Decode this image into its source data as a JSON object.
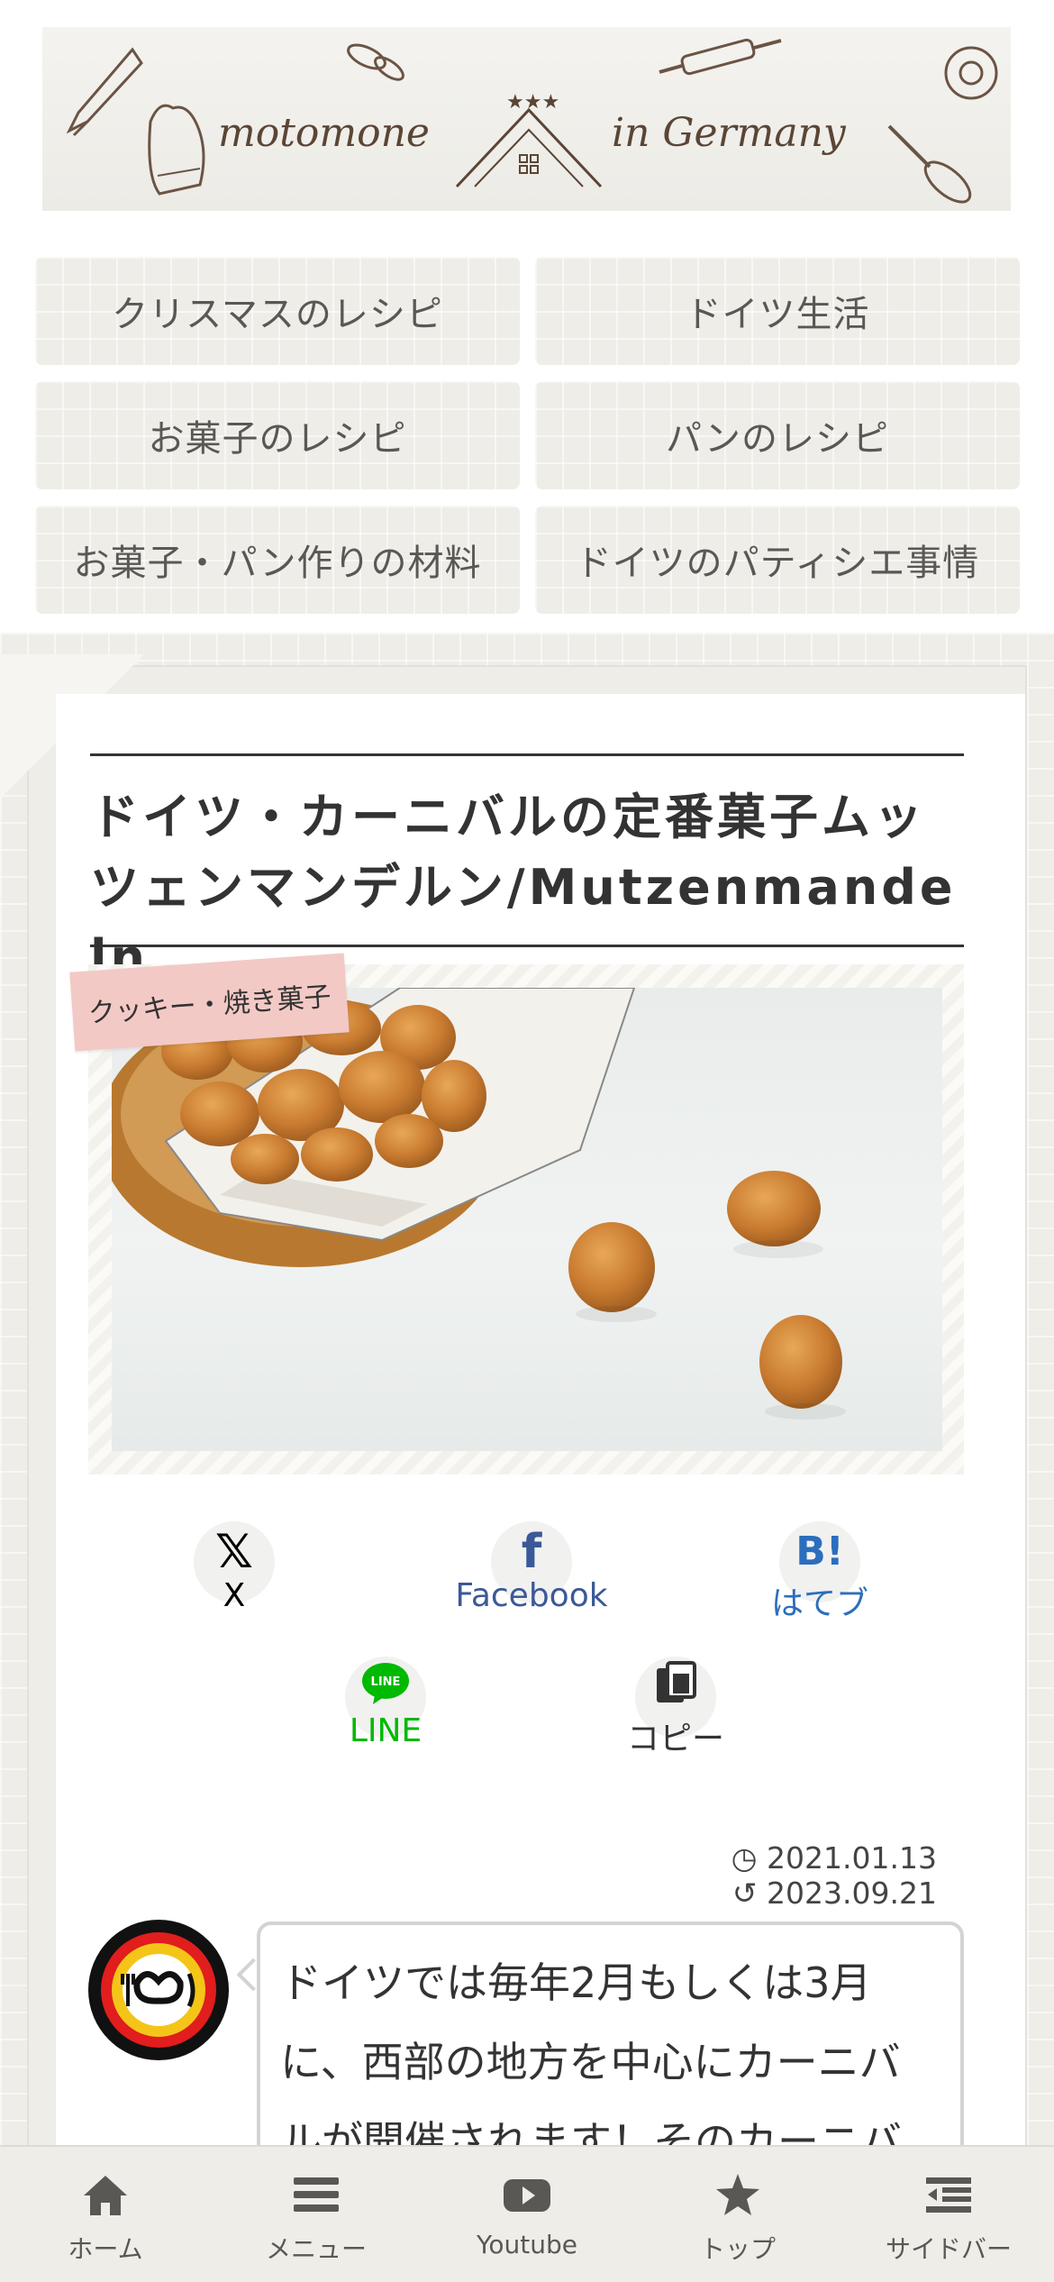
{
  "header": {
    "logo_left": "motomone",
    "logo_right": "in Germany"
  },
  "categories": [
    {
      "label": "クリスマスのレシピ"
    },
    {
      "label": "ドイツ生活"
    },
    {
      "label": "お菓子のレシピ"
    },
    {
      "label": "パンのレシピ"
    },
    {
      "label": "お菓子・パン作りの材料"
    },
    {
      "label": "ドイツのパティシエ事情"
    }
  ],
  "article": {
    "title": "ドイツ・カーニバルの定番菓子ムッツェンマンデルン/Mutzenmandeln",
    "category_tag": "クッキー・焼き菓子",
    "published": "2021.01.13",
    "updated": "2023.09.21",
    "intro_text": "ドイツでは毎年2月もしくは3月に、西部の地方を中心にカーニバルが開催されます！そのカーニバ"
  },
  "share": {
    "x": {
      "icon": "𝕏",
      "label": "X",
      "color": "#000000"
    },
    "facebook": {
      "icon": "f",
      "label": "Facebook",
      "color": "#3b5998"
    },
    "hatena": {
      "icon": "B!",
      "label": "はてブ",
      "color": "#2c6ebd"
    },
    "line": {
      "icon": "LINE",
      "label": "LINE",
      "color": "#00b900"
    },
    "copy": {
      "label": "コピー",
      "color": "#333333"
    }
  },
  "bottom_nav": [
    {
      "label": "ホーム",
      "icon": "home-icon"
    },
    {
      "label": "メニュー",
      "icon": "menu-icon"
    },
    {
      "label": "Youtube",
      "icon": "youtube-icon"
    },
    {
      "label": "トップ",
      "icon": "star-icon"
    },
    {
      "label": "サイドバー",
      "icon": "sidebar-icon"
    }
  ],
  "colors": {
    "background_grid": "#eeede7",
    "tag_pink": "#f3c9c6",
    "logo_brown": "#5b4535"
  }
}
